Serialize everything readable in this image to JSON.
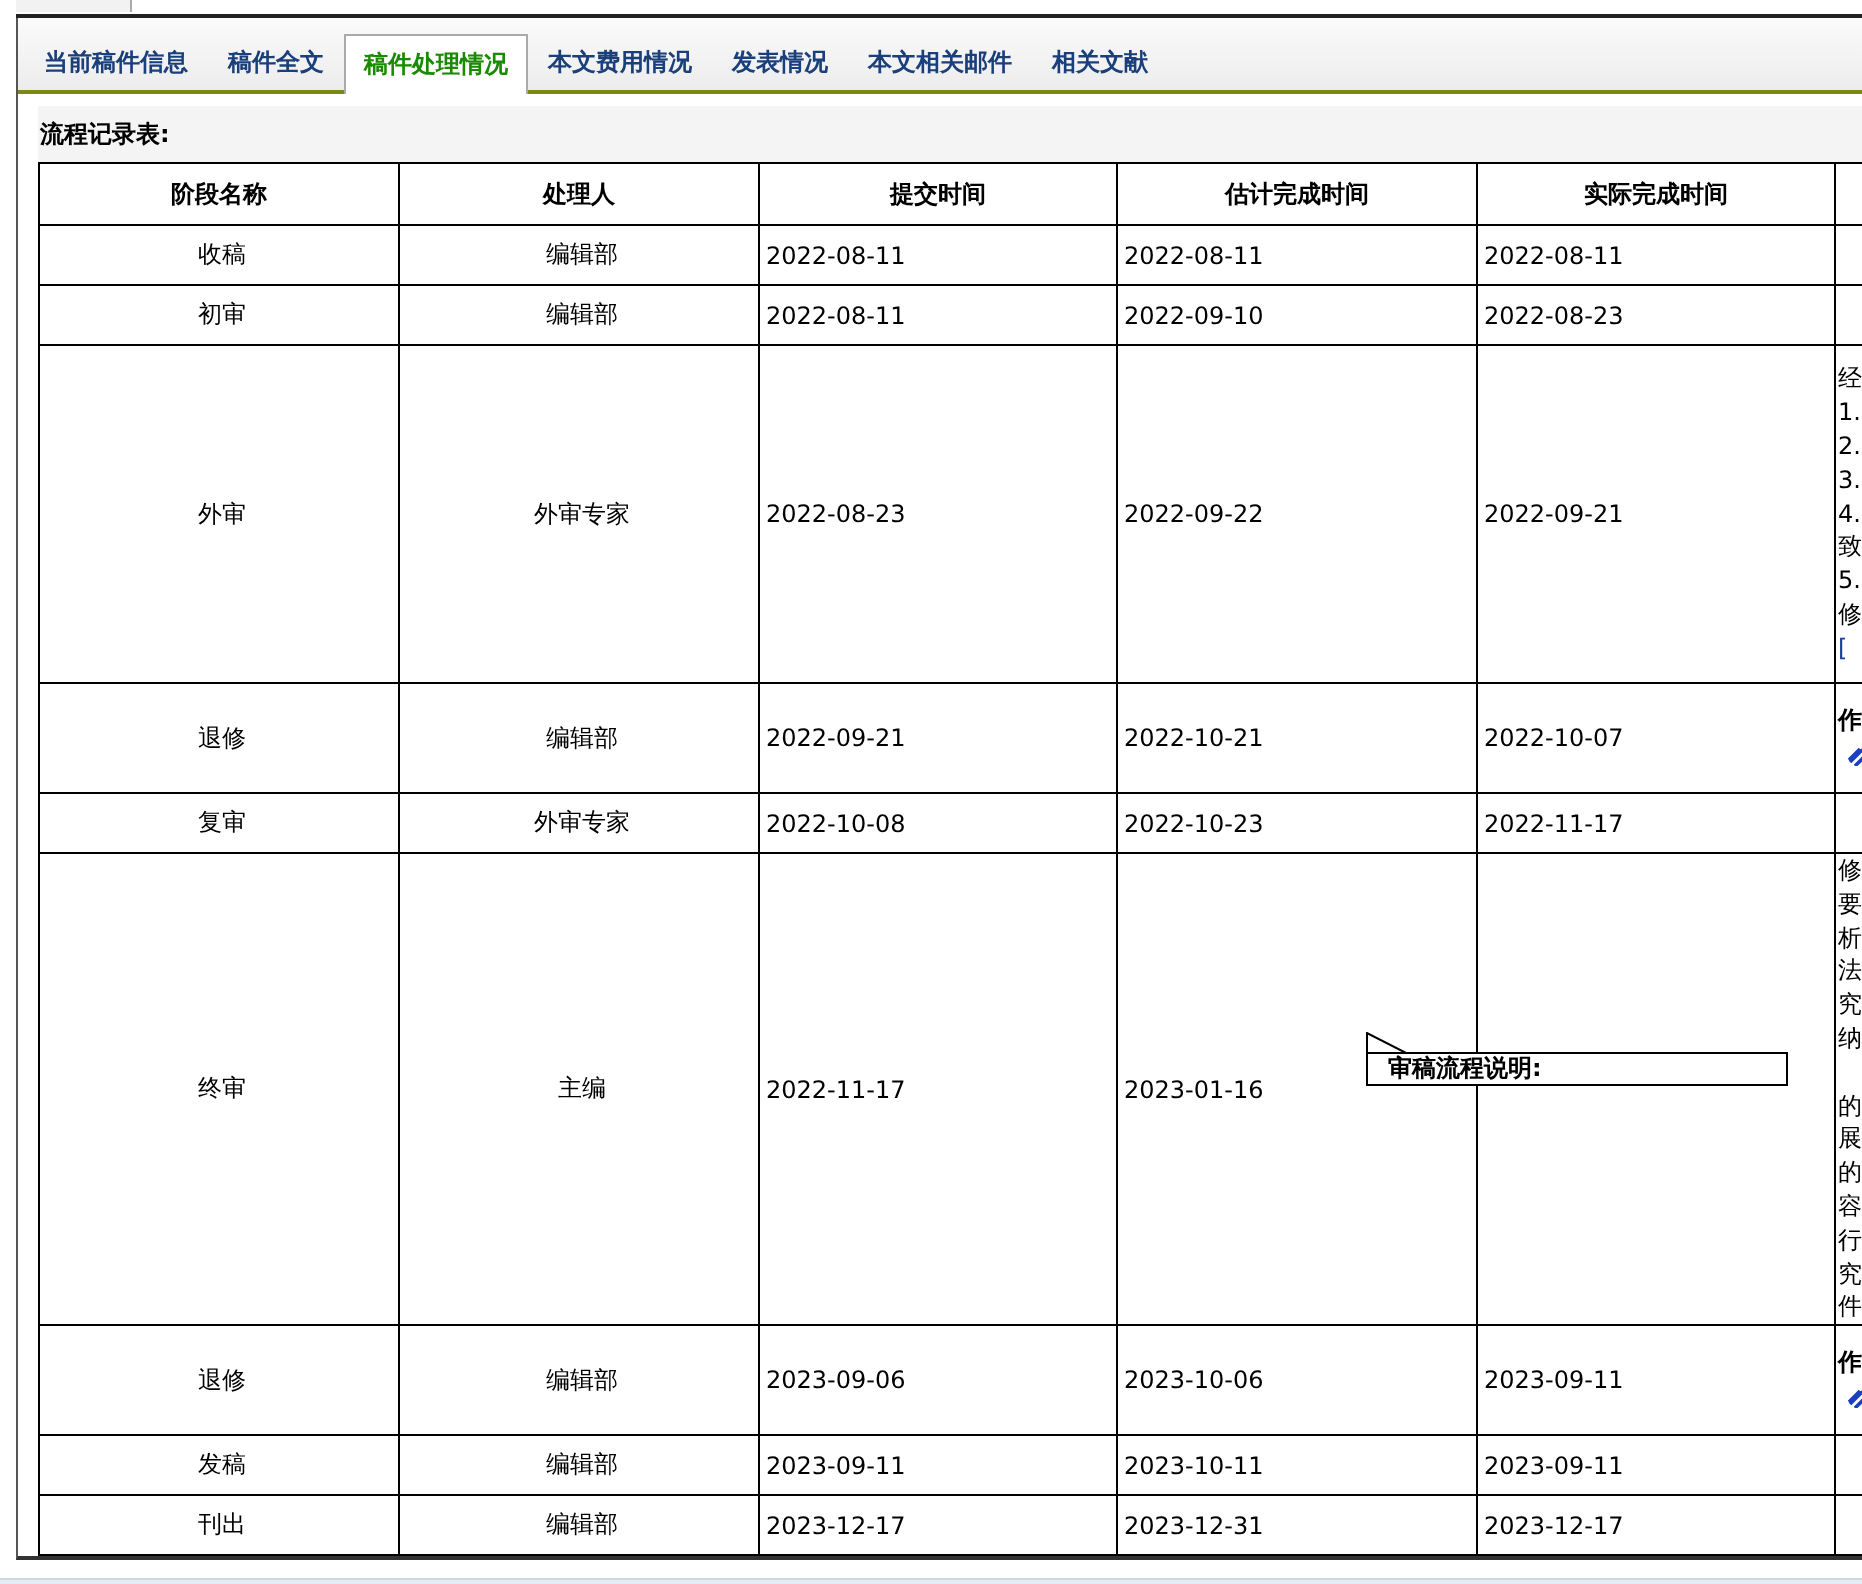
{
  "tabs": [
    {
      "label": "当前稿件信息",
      "selected": false
    },
    {
      "label": "稿件全文",
      "selected": false
    },
    {
      "label": "稿件处理情况",
      "selected": true
    },
    {
      "label": "本文费用情况",
      "selected": false
    },
    {
      "label": "发表情况",
      "selected": false
    },
    {
      "label": "本文相关邮件",
      "selected": false
    },
    {
      "label": "相关文献",
      "selected": false
    }
  ],
  "section_title": "流程记录表:",
  "table": {
    "columns": [
      "阶段名称",
      "处理人",
      "提交时间",
      "估计完成时间",
      "实际完成时间"
    ],
    "rows": [
      {
        "stage": "收稿",
        "handler": "编辑部",
        "submitted": "2022-08-11",
        "estimated": "2022-08-11",
        "actual": "2022-08-11",
        "notes": []
      },
      {
        "stage": "初审",
        "handler": "编辑部",
        "submitted": "2022-08-11",
        "estimated": "2022-09-10",
        "actual": "2022-08-23",
        "notes": []
      },
      {
        "stage": "外审",
        "handler": "外审专家",
        "submitted": "2022-08-23",
        "estimated": "2022-09-22",
        "actual": "2022-09-21",
        "notes": [
          {
            "kind": "text",
            "text": "经"
          },
          {
            "kind": "text",
            "text": "1."
          },
          {
            "kind": "text",
            "text": "2."
          },
          {
            "kind": "text",
            "text": "3."
          },
          {
            "kind": "text",
            "text": "4."
          },
          {
            "kind": "text",
            "text": "致"
          },
          {
            "kind": "text",
            "text": "5."
          },
          {
            "kind": "text",
            "text": "修"
          },
          {
            "kind": "link",
            "text": "["
          }
        ]
      },
      {
        "stage": "退修",
        "handler": "编辑部",
        "submitted": "2022-09-21",
        "estimated": "2022-10-21",
        "actual": "2022-10-07",
        "notes": [
          {
            "kind": "bold",
            "text": "作"
          },
          {
            "kind": "attachment"
          }
        ]
      },
      {
        "stage": "复审",
        "handler": "外审专家",
        "submitted": "2022-10-08",
        "estimated": "2022-10-23",
        "actual": "2022-11-17",
        "notes": []
      },
      {
        "stage": "终审",
        "handler": "主编",
        "submitted": "2022-11-17",
        "estimated": "2023-01-16",
        "notes": [
          {
            "kind": "text",
            "text": "修"
          },
          {
            "kind": "text",
            "text": "要"
          },
          {
            "kind": "text",
            "text": "析"
          },
          {
            "kind": "text",
            "text": "法"
          },
          {
            "kind": "text",
            "text": "究"
          },
          {
            "kind": "text",
            "text": "纳"
          },
          {
            "kind": "hidden"
          },
          {
            "kind": "text",
            "text": "的"
          },
          {
            "kind": "text",
            "text": "展"
          },
          {
            "kind": "text",
            "text": "的"
          },
          {
            "kind": "text",
            "text": "容"
          },
          {
            "kind": "text",
            "text": "行"
          },
          {
            "kind": "text",
            "text": "究"
          },
          {
            "kind": "text",
            "text": "件"
          }
        ]
      },
      {
        "stage": "退修",
        "handler": "编辑部",
        "submitted": "2023-09-06",
        "estimated": "2023-10-06",
        "actual": "2023-09-11",
        "notes": [
          {
            "kind": "bold",
            "text": "作"
          },
          {
            "kind": "attachment"
          }
        ]
      },
      {
        "stage": "发稿",
        "handler": "编辑部",
        "submitted": "2023-09-11",
        "estimated": "2023-10-11",
        "actual": "2023-09-11",
        "notes": []
      },
      {
        "stage": "刊出",
        "handler": "编辑部",
        "submitted": "2023-12-17",
        "estimated": "2023-12-31",
        "actual": "2023-12-17",
        "notes": []
      }
    ]
  },
  "tooltip": {
    "title": "审稿流程说明:"
  }
}
